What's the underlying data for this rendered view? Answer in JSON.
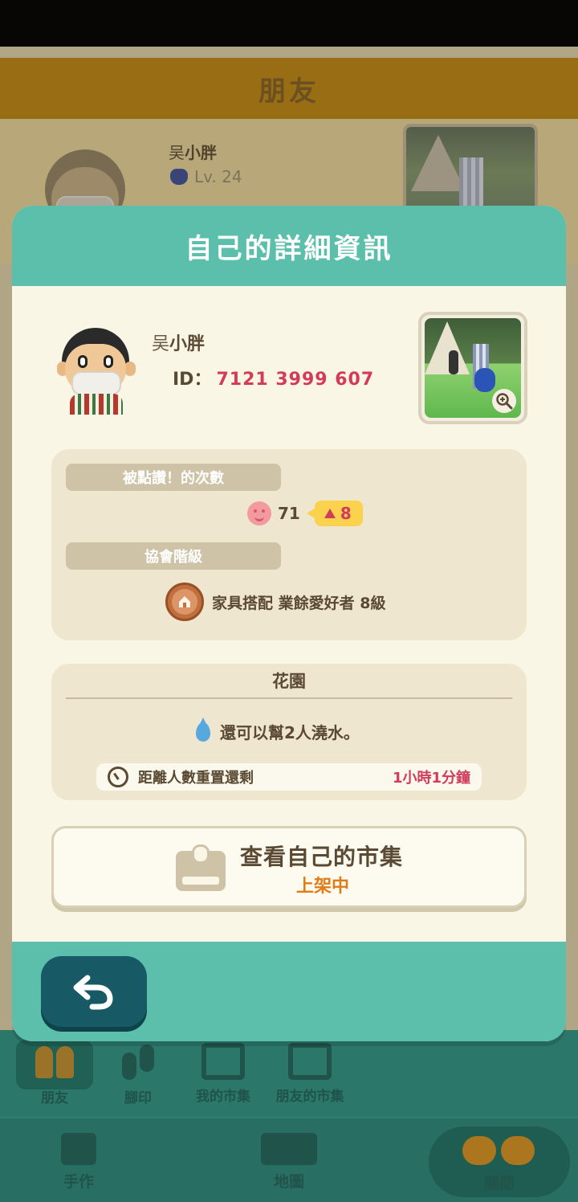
{
  "background": {
    "header_title": "朋友",
    "friend": {
      "name_prefix": "吴",
      "name_main": "小胖",
      "level": "Lv. 24"
    },
    "nav_top": [
      {
        "label": "朋友",
        "icon": "friends-icon",
        "selected": true
      },
      {
        "label": "腳印",
        "icon": "footprint-icon",
        "selected": false
      },
      {
        "label": "我的市集",
        "icon": "my-market-icon",
        "selected": false
      },
      {
        "label": "朋友的市集",
        "icon": "friends-market-icon",
        "selected": false
      }
    ],
    "nav_bottom": [
      {
        "label": "手作",
        "icon": "crafting-icon"
      },
      {
        "label": "地圖",
        "icon": "map-icon"
      },
      {
        "label": "關閉",
        "icon": "close-icon"
      }
    ]
  },
  "modal": {
    "title": "自己的詳細資訊",
    "profile": {
      "name_prefix": "吴",
      "name_main": "小胖",
      "id_label": "ID：",
      "id_value": "7121 3999 607"
    },
    "likes_label": "被點讚！的次數",
    "likes_count": "71",
    "likes_increase": "8",
    "rank_label": "協會階級",
    "rank_value": "家具搭配 業餘愛好者 8級",
    "garden": {
      "title": "花園",
      "water_text": "還可以幫2人澆水。",
      "reset_label": "距離人數重置還剩",
      "reset_remaining": "1小時1分鐘"
    },
    "market": {
      "title": "查看自己的市集",
      "status": "上架中"
    }
  },
  "colors": {
    "teal": "#5bbfab",
    "accent_red": "#d23b5a",
    "accent_orange": "#e07b17",
    "brown_text": "#5b4a33"
  }
}
